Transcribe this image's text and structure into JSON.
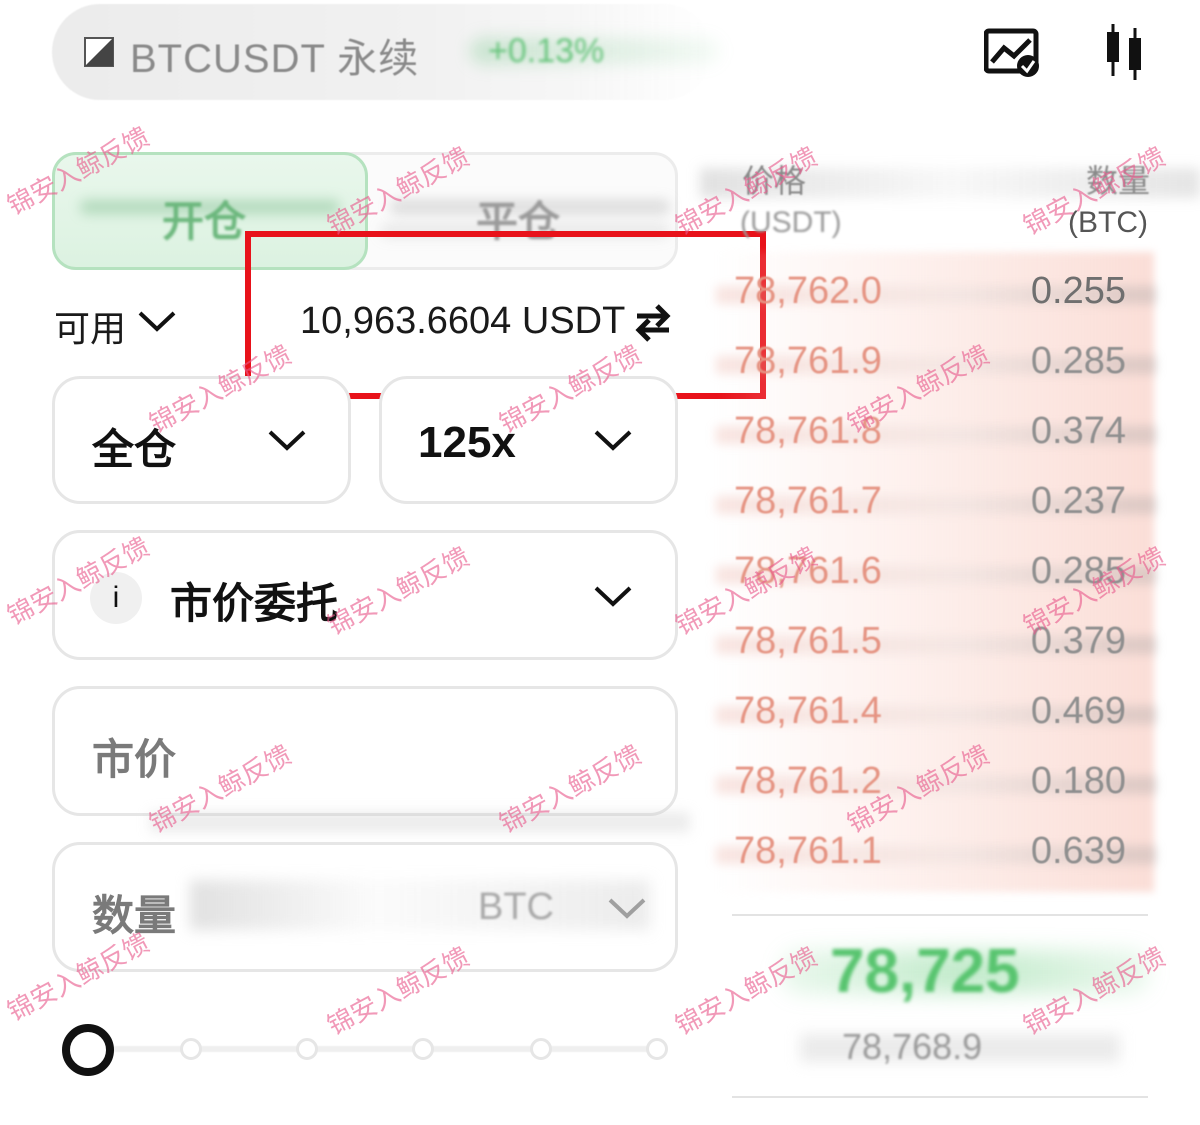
{
  "header": {
    "symbol": "BTCUSDT",
    "contract_type": "永续",
    "change": "+0.13%",
    "icons": [
      "chart-check-icon",
      "candlestick-icon"
    ]
  },
  "tabs": [
    {
      "label": "开仓",
      "active": true
    },
    {
      "label": "平仓",
      "active": false
    }
  ],
  "available": {
    "label": "可用",
    "value": "10,963.6604 USDT"
  },
  "margin_mode": "全仓",
  "leverage": "125x",
  "order_type": {
    "info_label": "i",
    "label": "市价委托"
  },
  "price_field": {
    "placeholder": "市价"
  },
  "quantity_field": {
    "label": "数量",
    "unit": "BTC"
  },
  "slider": {
    "value_percent": 0,
    "nodes": 5
  },
  "order_book": {
    "price_header": "价格",
    "price_unit": "(USDT)",
    "qty_header": "数量",
    "qty_unit": "(BTC)",
    "asks": [
      {
        "price": "78,762.0",
        "qty": "0.255"
      },
      {
        "price": "78,761.9",
        "qty": "0.285"
      },
      {
        "price": "78,761.8",
        "qty": "0.374"
      },
      {
        "price": "78,761.7",
        "qty": "0.237"
      },
      {
        "price": "78,761.6",
        "qty": "0.285"
      },
      {
        "price": "78,761.5",
        "qty": "0.379"
      },
      {
        "price": "78,761.4",
        "qty": "0.469"
      },
      {
        "price": "78,761.2",
        "qty": "0.180"
      },
      {
        "price": "78,761.1",
        "qty": "0.639"
      }
    ],
    "last_price": "78,725",
    "mark_price": "78,768.9"
  },
  "watermark": "锦安入鲸反馈",
  "colors": {
    "accent_green": "#58c46f",
    "ask_red": "#e59483",
    "highlight_red": "#e8121a",
    "watermark_pink": "#e95a8c"
  }
}
